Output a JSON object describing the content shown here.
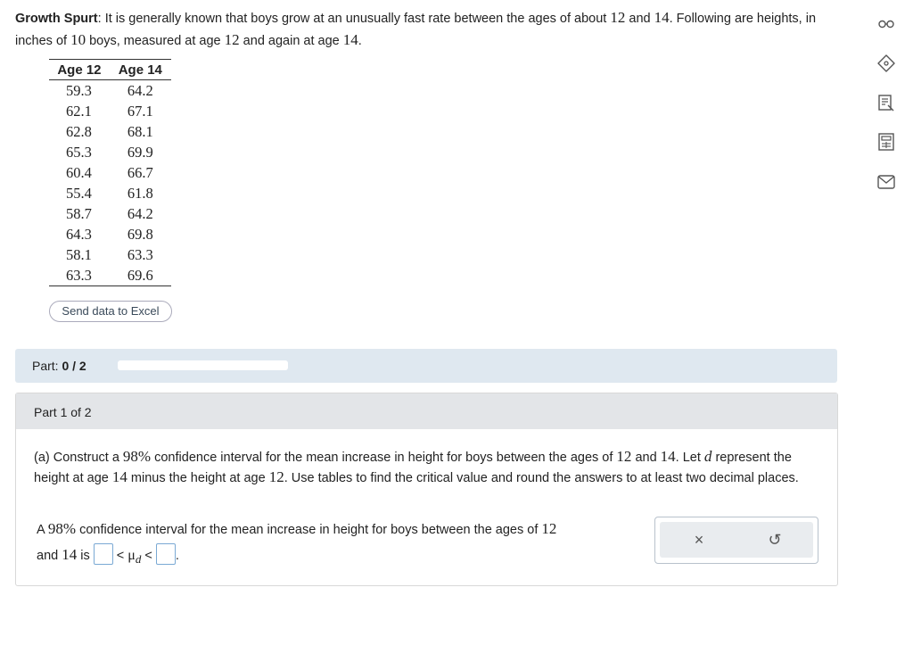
{
  "intro": {
    "title": "Growth Spurt",
    "t1": ": It is generally known that boys grow at an unusually fast rate between the ages of about ",
    "age1": "12",
    "and": " and ",
    "age2": "14",
    "t2": ". Following are heights, in inches of ",
    "n": "10",
    "t3": " boys, measured at age ",
    "t4": " and again at age ",
    "end": "."
  },
  "table": {
    "headers": [
      "Age 12",
      "Age 14"
    ],
    "rows": [
      [
        "59.3",
        "64.2"
      ],
      [
        "62.1",
        "67.1"
      ],
      [
        "62.8",
        "68.1"
      ],
      [
        "65.3",
        "69.9"
      ],
      [
        "60.4",
        "66.7"
      ],
      [
        "55.4",
        "61.8"
      ],
      [
        "58.7",
        "64.2"
      ],
      [
        "64.3",
        "69.8"
      ],
      [
        "58.1",
        "63.3"
      ],
      [
        "63.3",
        "69.6"
      ]
    ]
  },
  "excel_button": "Send data to Excel",
  "part_bar": {
    "label": "Part:",
    "value": "0 / 2",
    "progress": 0
  },
  "part_header": "Part 1 of 2",
  "question": {
    "a": "(a) Construct a ",
    "pct": "98%",
    "b": " confidence interval for the mean increase in height for boys between the ages of ",
    "age1": "12",
    "and": " and ",
    "age2": "14",
    "c": ". Let ",
    "d": "d",
    "e": " represent the height at age ",
    "f": " minus the height at age ",
    "g": ". Use tables to find the critical value and round the answers to at least two decimal places."
  },
  "answer": {
    "a": "A ",
    "pct": "98%",
    "b": " confidence interval for the mean increase in height for boys between the ages of ",
    "age1": "12",
    "c": "and ",
    "age2": "14",
    "d": " is ",
    "lt": "<",
    "mu": "μ",
    "sub": "d",
    "end": "."
  },
  "tools": {
    "clear": "×",
    "undo": "↺"
  },
  "sidebar": [
    "glasses-icon",
    "tag-icon",
    "notes-icon",
    "calculator-icon",
    "mail-icon"
  ]
}
